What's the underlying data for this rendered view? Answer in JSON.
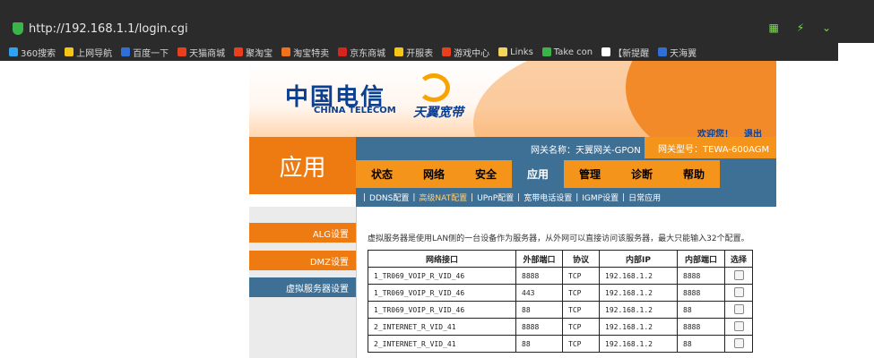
{
  "browser": {
    "url": "http://192.168.1.1/login.cgi",
    "bookmarks": [
      {
        "label": "360搜索",
        "color": "#2ea3f2"
      },
      {
        "label": "上网导航",
        "color": "#f5c518"
      },
      {
        "label": "百度一下",
        "color": "#2f6fd6"
      },
      {
        "label": "天猫商城",
        "color": "#e8401c"
      },
      {
        "label": "聚淘宝",
        "color": "#e8401c"
      },
      {
        "label": "淘宝特卖",
        "color": "#f2711c"
      },
      {
        "label": "京东商城",
        "color": "#d8241f"
      },
      {
        "label": "开服表",
        "color": "#f5c518"
      },
      {
        "label": "游戏中心",
        "color": "#e8401c"
      },
      {
        "label": "Links",
        "color": "#f5d45e"
      },
      {
        "label": "Take con",
        "color": "#3bb54a"
      },
      {
        "label": "【新提醒",
        "color": "#ffffff"
      },
      {
        "label": "天海翼",
        "color": "#2f6fd6"
      }
    ]
  },
  "header": {
    "logo_zh": "中国电信",
    "logo_en": "CHINA TELECOM",
    "tianyi": "天翼宽带",
    "welcome": "欢迎您！",
    "logout": "退出",
    "gateway_name": "网关名称：天翼网关-GPON",
    "gateway_model": "网关型号：TEWA-600AGM",
    "section_title": "应用"
  },
  "tabs": [
    {
      "label": "状态",
      "active": false
    },
    {
      "label": "网络",
      "active": false
    },
    {
      "label": "安全",
      "active": false
    },
    {
      "label": "应用",
      "active": true
    },
    {
      "label": "管理",
      "active": false
    },
    {
      "label": "诊断",
      "active": false
    },
    {
      "label": "帮助",
      "active": false
    }
  ],
  "subnav": [
    "DDNS配置",
    "高级NAT配置",
    "UPnP配置",
    "宽带电话设置",
    "IGMP设置",
    "日常应用"
  ],
  "sidebar": [
    "ALG设置",
    "DMZ设置",
    "虚拟服务器设置"
  ],
  "content": {
    "description": "虚拟服务器是使用LAN侧的一台设备作为服务器，从外网可以直接访问该服务器，最大只能输入32个配置。",
    "columns": [
      "网络接口",
      "外部端口",
      "协议",
      "内部IP",
      "内部端口",
      "选择"
    ],
    "rows": [
      [
        "1_TR069_VOIP_R_VID_46",
        "8888",
        "TCP",
        "192.168.1.2",
        "8888"
      ],
      [
        "1_TR069_VOIP_R_VID_46",
        "443",
        "TCP",
        "192.168.1.2",
        "8888"
      ],
      [
        "1_TR069_VOIP_R_VID_46",
        "88",
        "TCP",
        "192.168.1.2",
        "88"
      ],
      [
        "2_INTERNET_R_VID_41",
        "8888",
        "TCP",
        "192.168.1.2",
        "8888"
      ],
      [
        "2_INTERNET_R_VID_41",
        "88",
        "TCP",
        "192.168.1.2",
        "88"
      ]
    ]
  }
}
